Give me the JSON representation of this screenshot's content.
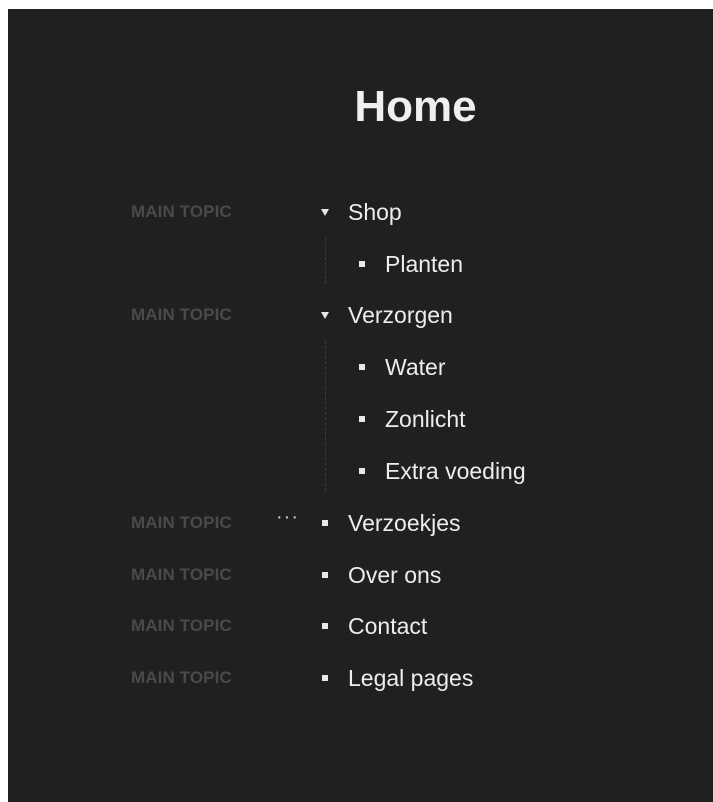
{
  "page": {
    "title": "Home"
  },
  "tree": {
    "topic_label": "MAIN TOPIC",
    "items": [
      {
        "label": "Shop",
        "topic": "MAIN TOPIC",
        "marker": "triangle-down-icon",
        "expanded": true,
        "children": [
          {
            "label": "Planten"
          }
        ]
      },
      {
        "label": "Verzorgen",
        "topic": "MAIN TOPIC",
        "marker": "triangle-down-icon",
        "expanded": true,
        "children": [
          {
            "label": "Water"
          },
          {
            "label": "Zonlicht"
          },
          {
            "label": "Extra voeding"
          }
        ]
      },
      {
        "label": "Verzoekjes",
        "topic": "MAIN TOPIC",
        "marker": "square-bullet-icon",
        "more": "···"
      },
      {
        "label": "Over ons",
        "topic": "MAIN TOPIC",
        "marker": "square-bullet-icon"
      },
      {
        "label": "Contact",
        "topic": "MAIN TOPIC",
        "marker": "square-bullet-icon"
      },
      {
        "label": "Legal pages",
        "topic": "MAIN TOPIC",
        "marker": "square-bullet-icon"
      }
    ]
  },
  "colors": {
    "panel_background": "#202020",
    "text": "#ededed",
    "topic_label": "#4a4a4a"
  }
}
